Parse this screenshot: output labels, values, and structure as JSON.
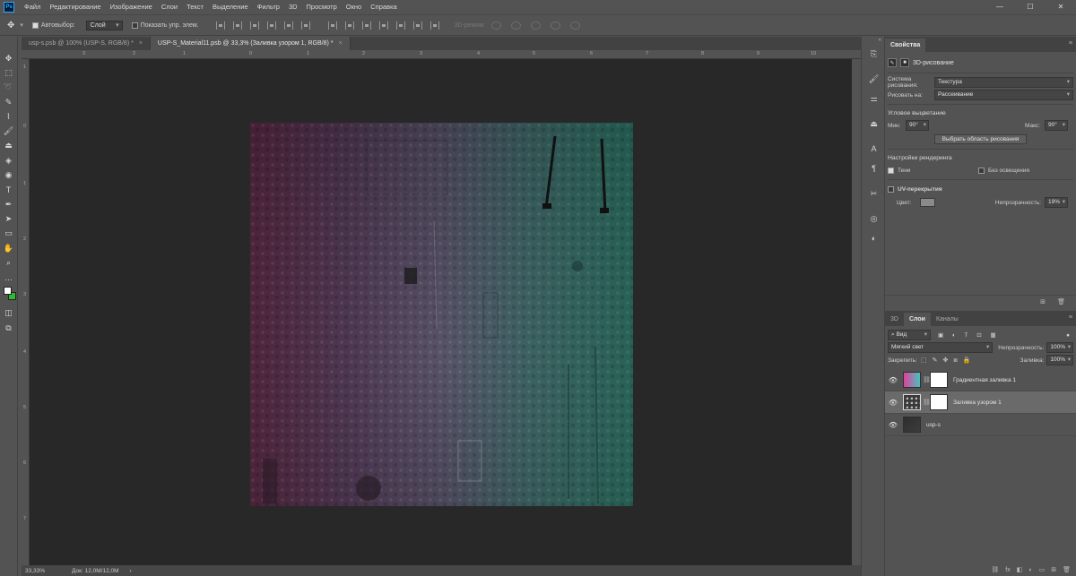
{
  "app": {
    "logo": "Ps"
  },
  "menu": [
    "Файл",
    "Редактирование",
    "Изображение",
    "Слои",
    "Текст",
    "Выделение",
    "Фильтр",
    "3D",
    "Просмотр",
    "Окно",
    "Справка"
  ],
  "window_controls": {
    "minimize": "—",
    "maximize": "☐",
    "close": "✕"
  },
  "options": {
    "autoselect_label": "Автовыбор:",
    "autoselect_value": "Слой",
    "show_transform_label": "Показать упр. элем.",
    "mode_3d_label": "3D-режим:"
  },
  "tabs": [
    {
      "label": "usp-s.psb @ 100% (USP-S, RGB/8) *",
      "close": "×"
    },
    {
      "label": "USP-S_Material11.psb @ 33,3% (Заливка узором 1, RGB/8) *",
      "close": "×"
    }
  ],
  "ruler_top": [
    "3",
    "2",
    "1",
    "0",
    "1",
    "2",
    "3",
    "4",
    "5",
    "6",
    "7",
    "8",
    "9",
    "10",
    "11",
    "12",
    "13",
    "14",
    "15",
    "16",
    "17"
  ],
  "ruler_left": [
    "1",
    "0",
    "1",
    "2",
    "3",
    "4",
    "5",
    "6",
    "7",
    "8",
    "9"
  ],
  "status": {
    "zoom": "33,33%",
    "doc": "Док: 12,0M/12,0M",
    "arrow": "›"
  },
  "properties": {
    "tab_label": "Свойства",
    "title": "3D-рисование",
    "paint_system_label": "Система рисования:",
    "paint_system_value": "Текстура",
    "paint_on_label": "Рисовать на:",
    "paint_on_value": "Рассеивание",
    "angle_fade_title": "Угловое выцветание",
    "min_label": "Мин:",
    "min_value": "90°",
    "max_label": "Макс:",
    "max_value": "90°",
    "select_area_button": "Выбрать область рисования",
    "render_settings_title": "Настройки рендеринга",
    "shadows_label": "Тени",
    "no_lighting_label": "Без освещения",
    "uv_overlay_label": "UV-перекрытия",
    "color_label": "Цвет:",
    "opacity_label": "Непрозрачность:",
    "opacity_value": "19%",
    "chip_color": "#8a8a8a"
  },
  "layers": {
    "tabs": [
      "3D",
      "Слои",
      "Каналы"
    ],
    "filter_label": "Вид",
    "blend_mode": "Мягкий свет",
    "opacity_label": "Непрозрачность:",
    "opacity_value": "100%",
    "lock_label": "Закрепить:",
    "fill_label": "Заливка:",
    "fill_value": "100%",
    "items": [
      {
        "name": "Градиентная заливка 1"
      },
      {
        "name": "Заливка узором 1"
      },
      {
        "name": "usp-s"
      }
    ]
  }
}
